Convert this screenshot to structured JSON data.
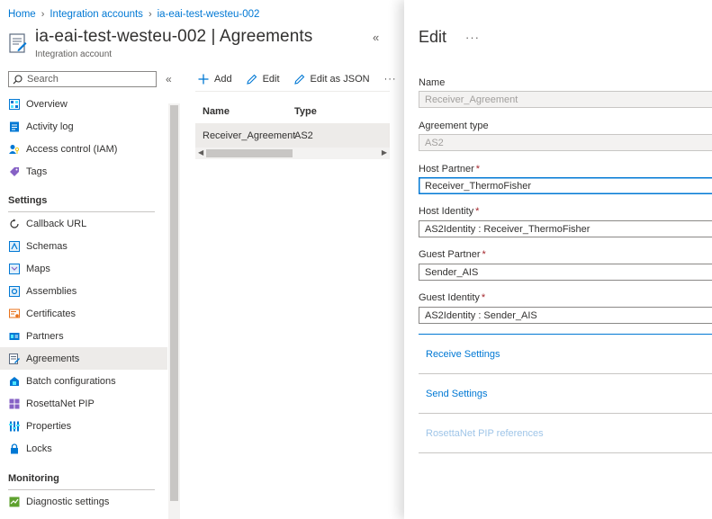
{
  "breadcrumb": {
    "items": [
      "Home",
      "Integration accounts",
      "ia-eai-test-westeu-002"
    ]
  },
  "header": {
    "title": "ia-eai-test-westeu-002 | Agreements",
    "subtitle": "Integration account",
    "collapse_glyph": "«"
  },
  "search": {
    "placeholder": "Search",
    "collapse_glyph": "«"
  },
  "sidebar": {
    "items_top": [
      {
        "label": "Overview",
        "icon": "overview-icon"
      },
      {
        "label": "Activity log",
        "icon": "activity-log-icon"
      },
      {
        "label": "Access control (IAM)",
        "icon": "access-control-icon"
      },
      {
        "label": "Tags",
        "icon": "tag-icon"
      }
    ],
    "settings_header": "Settings",
    "settings_items": [
      {
        "label": "Callback URL",
        "icon": "callback-icon"
      },
      {
        "label": "Schemas",
        "icon": "schemas-icon"
      },
      {
        "label": "Maps",
        "icon": "maps-icon"
      },
      {
        "label": "Assemblies",
        "icon": "assemblies-icon"
      },
      {
        "label": "Certificates",
        "icon": "certificate-icon"
      },
      {
        "label": "Partners",
        "icon": "partners-icon"
      },
      {
        "label": "Agreements",
        "icon": "agreements-icon",
        "active": true
      },
      {
        "label": "Batch configurations",
        "icon": "batch-icon"
      },
      {
        "label": "RosettaNet PIP",
        "icon": "rosettanet-icon"
      },
      {
        "label": "Properties",
        "icon": "properties-icon"
      },
      {
        "label": "Locks",
        "icon": "lock-icon"
      }
    ],
    "monitoring_header": "Monitoring",
    "monitoring_items": [
      {
        "label": "Diagnostic settings",
        "icon": "diagnostic-icon"
      }
    ]
  },
  "toolbar": {
    "add_label": "Add",
    "edit_label": "Edit",
    "edit_json_label": "Edit as JSON",
    "more_glyph": "···"
  },
  "grid": {
    "columns": [
      "Name",
      "Type"
    ],
    "rows": [
      {
        "name": "Receiver_Agreement",
        "type": "AS2"
      }
    ]
  },
  "edit_panel": {
    "title": "Edit",
    "more_glyph": "···",
    "fields": {
      "name": {
        "label": "Name",
        "value": "Receiver_Agreement"
      },
      "agreement_type": {
        "label": "Agreement type",
        "value": "AS2"
      },
      "host_partner": {
        "label": "Host Partner",
        "value": "Receiver_ThermoFisher"
      },
      "host_identity": {
        "label": "Host Identity",
        "value": "AS2Identity : Receiver_ThermoFisher"
      },
      "guest_partner": {
        "label": "Guest Partner",
        "value": "Sender_AIS"
      },
      "guest_identity": {
        "label": "Guest Identity",
        "value": "AS2Identity : Sender_AIS"
      }
    },
    "required_mark": "*",
    "sections": [
      "Receive Settings",
      "Send Settings",
      "RosettaNet PIP references"
    ]
  },
  "colors": {
    "accent": "#0078d4",
    "required": "#a4262c",
    "active_nav": "#edebe9"
  }
}
